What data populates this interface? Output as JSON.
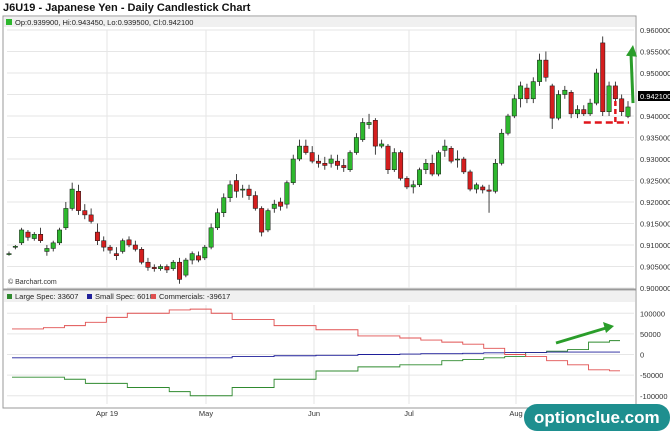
{
  "chart_data": [
    {
      "type": "candlestick",
      "title": "J6U19 - Japanese Yen - Daily Candlestick Chart",
      "ohlc_readout": "Op:0.939900, Hi:0.943450, Lo:0.939500, Cl:0.942100",
      "last_price_label": "0.942100",
      "credit": "© Barchart.com",
      "ylim": [
        0.9,
        0.96
      ],
      "y_ticks": [
        "0.960000",
        "0.955000",
        "0.950000",
        "0.945000",
        "0.940000",
        "0.935000",
        "0.930000",
        "0.925000",
        "0.920000",
        "0.915000",
        "0.910000",
        "0.905000",
        "0.900000"
      ],
      "x_ticks": [
        "Apr 19",
        "May",
        "Jun",
        "Jul",
        "Aug"
      ],
      "candles": [
        [
          0.908,
          0.9085,
          0.9075,
          0.908
        ],
        [
          0.9095,
          0.91,
          0.909,
          0.9097
        ],
        [
          0.9105,
          0.914,
          0.91,
          0.9135
        ],
        [
          0.913,
          0.9135,
          0.911,
          0.9118
        ],
        [
          0.9115,
          0.913,
          0.911,
          0.9125
        ],
        [
          0.9125,
          0.914,
          0.9105,
          0.911
        ],
        [
          0.9085,
          0.91,
          0.9075,
          0.9092
        ],
        [
          0.9092,
          0.911,
          0.9085,
          0.9105
        ],
        [
          0.9105,
          0.914,
          0.91,
          0.9135
        ],
        [
          0.914,
          0.92,
          0.9135,
          0.9185
        ],
        [
          0.9185,
          0.9245,
          0.918,
          0.923
        ],
        [
          0.9225,
          0.924,
          0.917,
          0.918
        ],
        [
          0.918,
          0.9195,
          0.916,
          0.917
        ],
        [
          0.917,
          0.9185,
          0.915,
          0.9155
        ],
        [
          0.913,
          0.915,
          0.91,
          0.911
        ],
        [
          0.911,
          0.912,
          0.9085,
          0.9095
        ],
        [
          0.9095,
          0.91,
          0.908,
          0.9088
        ],
        [
          0.908,
          0.9095,
          0.9065,
          0.9075
        ],
        [
          0.9085,
          0.9115,
          0.908,
          0.911
        ],
        [
          0.9112,
          0.912,
          0.9095,
          0.91
        ],
        [
          0.91,
          0.911,
          0.9085,
          0.909
        ],
        [
          0.909,
          0.9095,
          0.9055,
          0.906
        ],
        [
          0.906,
          0.907,
          0.904,
          0.9048
        ],
        [
          0.9048,
          0.9055,
          0.9038,
          0.9045
        ],
        [
          0.9045,
          0.9055,
          0.904,
          0.905
        ],
        [
          0.905,
          0.9055,
          0.9035,
          0.9042
        ],
        [
          0.9045,
          0.9065,
          0.904,
          0.906
        ],
        [
          0.906,
          0.907,
          0.901,
          0.902
        ],
        [
          0.903,
          0.907,
          0.9025,
          0.9065
        ],
        [
          0.9065,
          0.9085,
          0.9055,
          0.908
        ],
        [
          0.9075,
          0.9085,
          0.906,
          0.9065
        ],
        [
          0.907,
          0.91,
          0.9065,
          0.9095
        ],
        [
          0.9095,
          0.915,
          0.909,
          0.914
        ],
        [
          0.914,
          0.9185,
          0.9135,
          0.9175
        ],
        [
          0.9175,
          0.922,
          0.9165,
          0.921
        ],
        [
          0.921,
          0.925,
          0.92,
          0.924
        ],
        [
          0.925,
          0.9265,
          0.921,
          0.9225
        ],
        [
          0.923,
          0.924,
          0.921,
          0.923
        ],
        [
          0.923,
          0.924,
          0.9205,
          0.9215
        ],
        [
          0.9215,
          0.9225,
          0.918,
          0.9185
        ],
        [
          0.9185,
          0.919,
          0.912,
          0.913
        ],
        [
          0.9135,
          0.9185,
          0.913,
          0.918
        ],
        [
          0.9185,
          0.9205,
          0.9175,
          0.9195
        ],
        [
          0.92,
          0.921,
          0.918,
          0.919
        ],
        [
          0.9195,
          0.925,
          0.9185,
          0.9245
        ],
        [
          0.9245,
          0.931,
          0.924,
          0.93
        ],
        [
          0.93,
          0.9345,
          0.9295,
          0.933
        ],
        [
          0.933,
          0.9345,
          0.931,
          0.9315
        ],
        [
          0.9315,
          0.933,
          0.929,
          0.9295
        ],
        [
          0.9295,
          0.931,
          0.928,
          0.929
        ],
        [
          0.929,
          0.9305,
          0.9275,
          0.9285
        ],
        [
          0.929,
          0.931,
          0.928,
          0.93
        ],
        [
          0.9295,
          0.931,
          0.9275,
          0.9285
        ],
        [
          0.9285,
          0.93,
          0.927,
          0.928
        ],
        [
          0.9275,
          0.932,
          0.927,
          0.9315
        ],
        [
          0.9315,
          0.936,
          0.931,
          0.935
        ],
        [
          0.9345,
          0.9395,
          0.934,
          0.9385
        ],
        [
          0.938,
          0.9405,
          0.937,
          0.9385
        ],
        [
          0.939,
          0.9395,
          0.931,
          0.933
        ],
        [
          0.933,
          0.9345,
          0.9325,
          0.9335
        ],
        [
          0.933,
          0.9335,
          0.9265,
          0.9275
        ],
        [
          0.9275,
          0.9325,
          0.927,
          0.9315
        ],
        [
          0.9315,
          0.932,
          0.925,
          0.9255
        ],
        [
          0.9255,
          0.926,
          0.923,
          0.9235
        ],
        [
          0.9235,
          0.925,
          0.922,
          0.924
        ],
        [
          0.924,
          0.928,
          0.9235,
          0.9275
        ],
        [
          0.9275,
          0.93,
          0.9265,
          0.929
        ],
        [
          0.929,
          0.931,
          0.926,
          0.9265
        ],
        [
          0.9265,
          0.932,
          0.926,
          0.9315
        ],
        [
          0.932,
          0.9345,
          0.9305,
          0.933
        ],
        [
          0.9325,
          0.933,
          0.929,
          0.9295
        ],
        [
          0.93,
          0.932,
          0.928,
          0.93
        ],
        [
          0.93,
          0.9305,
          0.9265,
          0.927
        ],
        [
          0.927,
          0.9275,
          0.9225,
          0.923
        ],
        [
          0.923,
          0.9245,
          0.922,
          0.924
        ],
        [
          0.9235,
          0.924,
          0.922,
          0.9228
        ],
        [
          0.9228,
          0.924,
          0.9175,
          0.9225
        ],
        [
          0.9225,
          0.93,
          0.922,
          0.929
        ],
        [
          0.929,
          0.937,
          0.9285,
          0.936
        ],
        [
          0.936,
          0.9405,
          0.9355,
          0.94
        ],
        [
          0.94,
          0.945,
          0.9395,
          0.944
        ],
        [
          0.944,
          0.948,
          0.942,
          0.947
        ],
        [
          0.9465,
          0.9475,
          0.943,
          0.944
        ],
        [
          0.944,
          0.949,
          0.943,
          0.948
        ],
        [
          0.948,
          0.9545,
          0.947,
          0.953
        ],
        [
          0.953,
          0.955,
          0.948,
          0.949
        ],
        [
          0.947,
          0.9475,
          0.937,
          0.9395
        ],
        [
          0.9395,
          0.946,
          0.939,
          0.945
        ],
        [
          0.945,
          0.947,
          0.944,
          0.946
        ],
        [
          0.9455,
          0.946,
          0.9395,
          0.9405
        ],
        [
          0.9405,
          0.9425,
          0.9395,
          0.9415
        ],
        [
          0.9415,
          0.9425,
          0.94,
          0.9405
        ],
        [
          0.9405,
          0.944,
          0.94,
          0.943
        ],
        [
          0.943,
          0.951,
          0.9425,
          0.95
        ],
        [
          0.957,
          0.9585,
          0.94,
          0.941
        ],
        [
          0.941,
          0.948,
          0.94,
          0.947
        ],
        [
          0.947,
          0.948,
          0.943,
          0.944
        ],
        [
          0.944,
          0.945,
          0.94,
          0.941
        ],
        [
          0.9399,
          0.94345,
          0.9395,
          0.9421
        ]
      ],
      "annotations": {
        "support_level": 0.9385,
        "arrow_color": "#2a9d2a",
        "support_color": "#e0151b"
      },
      "colors": {
        "up": "#2eb82e",
        "down": "#d41e1e"
      }
    },
    {
      "type": "line",
      "title": "",
      "ylim": [
        -120000,
        120000
      ],
      "y_ticks": [
        "100000",
        "50000",
        "0",
        "-50000",
        "-100000"
      ],
      "series": [
        {
          "name": "Large Spec: 33607",
          "color": "#2f8a2f",
          "values": [
            -55000,
            -55000,
            -55000,
            -60000,
            -70000,
            -70000,
            -80000,
            -80000,
            -90000,
            -100000,
            -100000,
            -80000,
            -80000,
            -60000,
            -60000,
            -40000,
            -40000,
            -30000,
            -30000,
            -25000,
            -25000,
            -15000,
            -12000,
            -8000,
            -5000,
            5000,
            8000,
            12000,
            30000,
            33607
          ]
        },
        {
          "name": "Small Spec: 6010",
          "color": "#1f1f9a",
          "values": [
            -8000,
            -8000,
            -8000,
            -8000,
            -8000,
            -8000,
            -8000,
            -8000,
            -8000,
            -8000,
            -8000,
            -5000,
            -5000,
            -3000,
            -3000,
            -2000,
            -2000,
            0,
            0,
            1000,
            2000,
            2000,
            3000,
            4000,
            5000,
            5000,
            6010,
            6010,
            6010,
            6010
          ]
        },
        {
          "name": "Commercials: -39617",
          "color": "#e05050",
          "values": [
            62000,
            62000,
            65000,
            70000,
            78000,
            90000,
            100000,
            100000,
            108000,
            110000,
            100000,
            85000,
            85000,
            70000,
            70000,
            60000,
            60000,
            45000,
            45000,
            40000,
            35000,
            30000,
            25000,
            15000,
            0,
            -5000,
            -15000,
            -25000,
            -37000,
            -39617
          ]
        }
      ]
    }
  ],
  "watermark": "optionclue.com"
}
